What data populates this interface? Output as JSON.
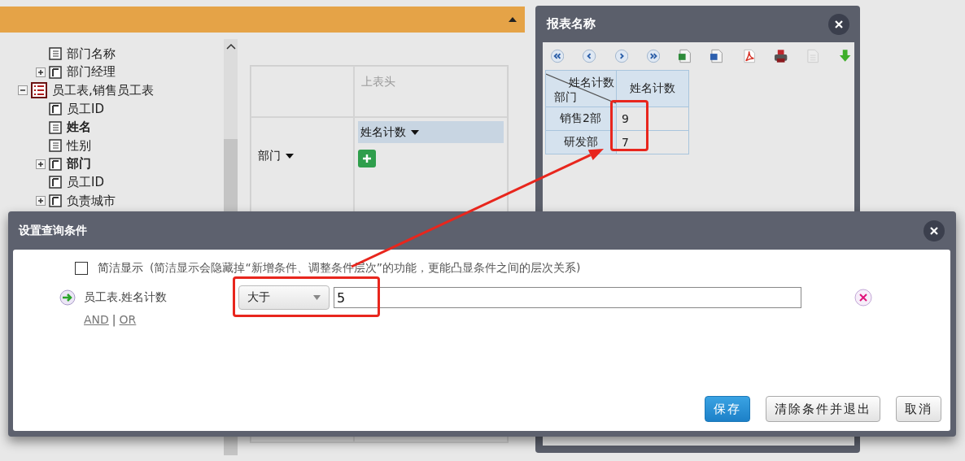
{
  "tree": {
    "items": [
      {
        "children": [
          {
            "label": "部门名称",
            "kind": "text",
            "used": false
          },
          {
            "label": "部门经理",
            "kind": "dimension",
            "used": false,
            "expanded": false
          }
        ]
      },
      {
        "label": "员工表,销售员工表",
        "kind": "table",
        "used": false,
        "expanded": true,
        "children": [
          {
            "label": "员工ID",
            "kind": "dimension",
            "used": false
          },
          {
            "label": "姓名",
            "kind": "text",
            "used": true
          },
          {
            "label": "性别",
            "kind": "text",
            "used": false
          },
          {
            "label": "部门",
            "kind": "dimension",
            "used": true,
            "expanded": false
          },
          {
            "label": "员工ID",
            "kind": "dimension",
            "used": false
          },
          {
            "label": "负责城市",
            "kind": "dimension",
            "used": false,
            "expanded": false
          }
        ]
      }
    ]
  },
  "pivot": {
    "column_area": {
      "placeholder": "上表头"
    },
    "row_field": "部门",
    "value_field": "姓名计数"
  },
  "report_window": {
    "title": "报表名称",
    "toolbar": [
      {
        "kind": "first",
        "disabled": false
      },
      {
        "kind": "prev",
        "disabled": false
      },
      {
        "kind": "next",
        "disabled": false
      },
      {
        "kind": "last",
        "disabled": false
      },
      {
        "kind": "excel",
        "disabled": false
      },
      {
        "kind": "word",
        "disabled": false
      },
      {
        "kind": "pdf",
        "disabled": false
      },
      {
        "kind": "print",
        "disabled": false
      },
      {
        "kind": "text",
        "disabled": true
      },
      {
        "kind": "download",
        "disabled": false
      }
    ],
    "table": {
      "corner": {
        "column_field": "姓名计数",
        "row_field": "部门"
      },
      "columns": [
        "",
        "姓名计数"
      ],
      "rows": [
        [
          "销售2部",
          "9"
        ],
        [
          "研发部",
          "7"
        ]
      ]
    }
  },
  "dialog": {
    "title": "设置查询条件",
    "simple_display": {
      "label": "简洁显示",
      "checked": false,
      "note": "(简洁显示会隐藏掉“新增条件、调整条件层次”的功能，更能凸显条件之间的层次关系)"
    },
    "conditions": [
      {
        "field": "员工表.姓名计数",
        "operator": "大于",
        "value": "5"
      }
    ],
    "logic": {
      "and": "AND",
      "separator": "|",
      "or": "OR"
    },
    "buttons": [
      {
        "label": "保存",
        "kind": "primary"
      },
      {
        "label": "清除条件并退出",
        "kind": "default"
      },
      {
        "label": "取消",
        "kind": "default"
      }
    ]
  }
}
